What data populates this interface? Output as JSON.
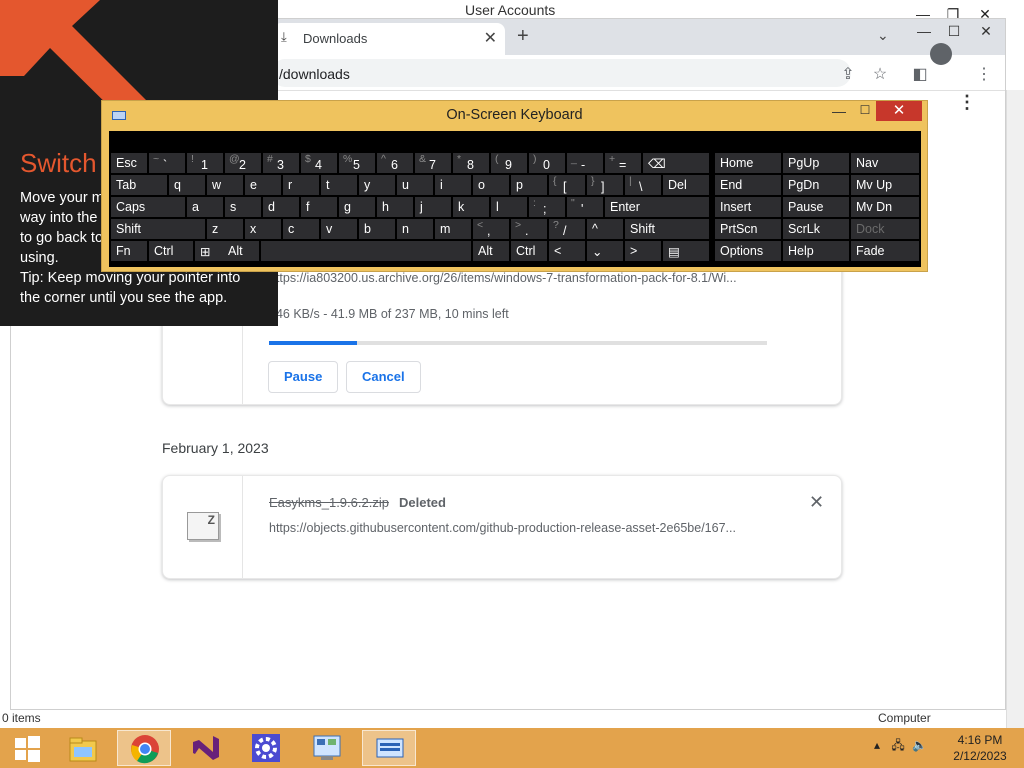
{
  "background_window": {
    "title": "User Accounts",
    "status_left": "0 items",
    "status_right": "Computer"
  },
  "browser": {
    "tab_title": "Downloads",
    "url": "/downloads",
    "icons": [
      "download-icon",
      "new-tab-icon",
      "tab-search-icon",
      "share-icon",
      "bookmark-star-icon",
      "side-panel-icon",
      "profile-avatar-icon",
      "chrome-menu-icon"
    ]
  },
  "downloads": {
    "in_progress": {
      "url": "https://ia803200.us.archive.org/26/items/windows-7-transformation-pack-for-8.1/Wi...",
      "status": "346 KB/s - 41.9 MB of 237 MB, 10 mins left",
      "progress": 0.177,
      "pause_label": "Pause",
      "cancel_label": "Cancel"
    },
    "date_header": "February 1, 2023",
    "deleted_item": {
      "filename": "Easykms_1.9.6.2.zip",
      "status": "Deleted",
      "url": "https://objects.githubusercontent.com/github-production-release-asset-2e65be/167..."
    }
  },
  "switch_hint": {
    "title": "Switch",
    "line1": "Move your m",
    "line2": "way into the",
    "line3": "to go back to",
    "line4": "using.",
    "line5": "Tip: Keep moving your pointer into",
    "line6": "the corner until you see the app."
  },
  "osk": {
    "title": "On-Screen Keyboard",
    "rows": [
      [
        {
          "l": "Esc"
        },
        {
          "s": "~",
          "m": "`"
        },
        {
          "s": "!",
          "m": "1"
        },
        {
          "s": "@",
          "m": "2"
        },
        {
          "s": "#",
          "m": "3"
        },
        {
          "s": "$",
          "m": "4"
        },
        {
          "s": "%",
          "m": "5"
        },
        {
          "s": "^",
          "m": "6"
        },
        {
          "s": "&",
          "m": "7"
        },
        {
          "s": "*",
          "m": "8"
        },
        {
          "s": "(",
          "m": "9"
        },
        {
          "s": ")",
          "m": "0"
        },
        {
          "s": "_",
          "m": "-"
        },
        {
          "s": "+",
          "m": "="
        },
        {
          "l": "⌫"
        }
      ],
      [
        {
          "l": "Tab"
        },
        {
          "l": "q"
        },
        {
          "l": "w"
        },
        {
          "l": "e"
        },
        {
          "l": "r"
        },
        {
          "l": "t"
        },
        {
          "l": "y"
        },
        {
          "l": "u"
        },
        {
          "l": "i"
        },
        {
          "l": "o"
        },
        {
          "l": "p"
        },
        {
          "s": "{",
          "m": "["
        },
        {
          "s": "}",
          "m": "]"
        },
        {
          "s": "|",
          "m": "\\"
        },
        {
          "l": "Del"
        }
      ],
      [
        {
          "l": "Caps"
        },
        {
          "l": "a"
        },
        {
          "l": "s"
        },
        {
          "l": "d"
        },
        {
          "l": "f"
        },
        {
          "l": "g"
        },
        {
          "l": "h"
        },
        {
          "l": "j"
        },
        {
          "l": "k"
        },
        {
          "l": "l"
        },
        {
          "s": ":",
          "m": ";"
        },
        {
          "s": "\"",
          "m": "'"
        },
        {
          "l": "Enter"
        }
      ],
      [
        {
          "l": "Shift"
        },
        {
          "l": "z"
        },
        {
          "l": "x"
        },
        {
          "l": "c"
        },
        {
          "l": "v"
        },
        {
          "l": "b"
        },
        {
          "l": "n"
        },
        {
          "l": "m"
        },
        {
          "s": "<",
          "m": ","
        },
        {
          "s": ">",
          "m": "."
        },
        {
          "s": "?",
          "m": "/"
        },
        {
          "l": "^"
        },
        {
          "l": "Shift"
        }
      ],
      [
        {
          "l": "Fn"
        },
        {
          "l": "Ctrl"
        },
        {
          "l": "⊞"
        },
        {
          "l": "Alt"
        },
        {
          "l": ""
        },
        {
          "l": "Alt"
        },
        {
          "l": "Ctrl"
        },
        {
          "l": "<"
        },
        {
          "l": "⌄"
        },
        {
          "l": ">"
        },
        {
          "l": "▤"
        }
      ]
    ],
    "nav_keys": [
      [
        "Home",
        "PgUp",
        "Nav"
      ],
      [
        "End",
        "PgDn",
        "Mv Up"
      ],
      [
        "Insert",
        "Pause",
        "Mv Dn"
      ],
      [
        "PrtScn",
        "ScrLk",
        "Dock"
      ],
      [
        "Options",
        "Help",
        "Fade"
      ]
    ]
  },
  "taskbar": {
    "apps": [
      "start-icon",
      "file-explorer-icon",
      "chrome-icon",
      "visual-studio-icon",
      "settings-gear-icon",
      "control-panel-icon",
      "on-screen-keyboard-icon"
    ],
    "time": "4:16 PM",
    "date": "2/12/2023"
  }
}
